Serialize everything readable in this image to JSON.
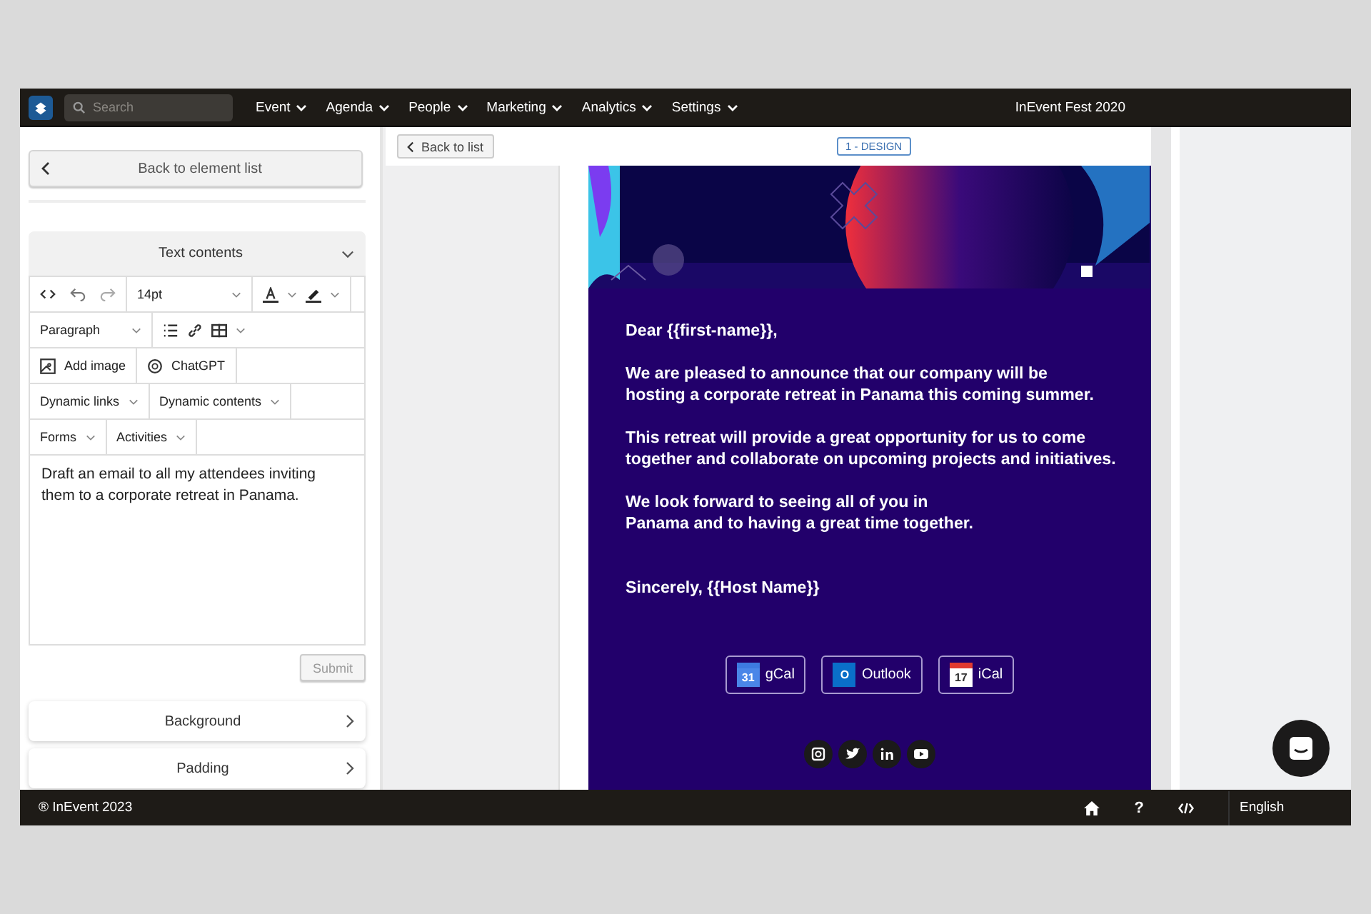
{
  "nav": {
    "search": {
      "placeholder": "Search"
    },
    "menus": [
      "Event",
      "Agenda",
      "People",
      "Marketing",
      "Analytics",
      "Settings"
    ],
    "event_title": "InEvent Fest 2020"
  },
  "editor_panel": {
    "back_button": "Back to element list",
    "section": {
      "title": "Text contents",
      "expanded": true
    },
    "font_size": "14pt",
    "block_format": "Paragraph",
    "add_image": "Add image",
    "chatgpt": "ChatGPT",
    "dropdown_rows": [
      [
        "Dynamic links",
        "Dynamic contents"
      ],
      [
        "Forms",
        "Activities"
      ]
    ],
    "prompt": "Draft an email to all my attendees inviting them to a corporate retreat in Panama.",
    "submit": {
      "label": "Submit",
      "disabled": true
    },
    "accordions": [
      "Background",
      "Padding"
    ]
  },
  "preview": {
    "back_button": "Back to list",
    "step": "1 - DESIGN",
    "email": {
      "greeting": "Dear {{first-name}},",
      "paragraphs": [
        "We are pleased to announce that our company will be\nhosting a corporate retreat in Panama this coming summer.",
        "This retreat will provide a great opportunity for us to come\ntogether and collaborate on upcoming projects and initiatives.",
        "We look forward to seeing all of you in\nPanama and to having a great time together."
      ],
      "signoff": "Sincerely, {{Host Name}}",
      "calendar_buttons": [
        {
          "kind": "gcal",
          "label": "gCal",
          "icon_text": "31"
        },
        {
          "kind": "outlook",
          "label": "Outlook",
          "icon_text": "O"
        },
        {
          "kind": "ical",
          "label": "iCal",
          "icon_text": "17"
        }
      ],
      "social": [
        {
          "kind": "instagram"
        },
        {
          "kind": "twitter"
        },
        {
          "kind": "linkedin"
        },
        {
          "kind": "youtube"
        }
      ]
    }
  },
  "footer": {
    "copyright": "® InEvent 2023",
    "help": "?",
    "language": "English"
  }
}
